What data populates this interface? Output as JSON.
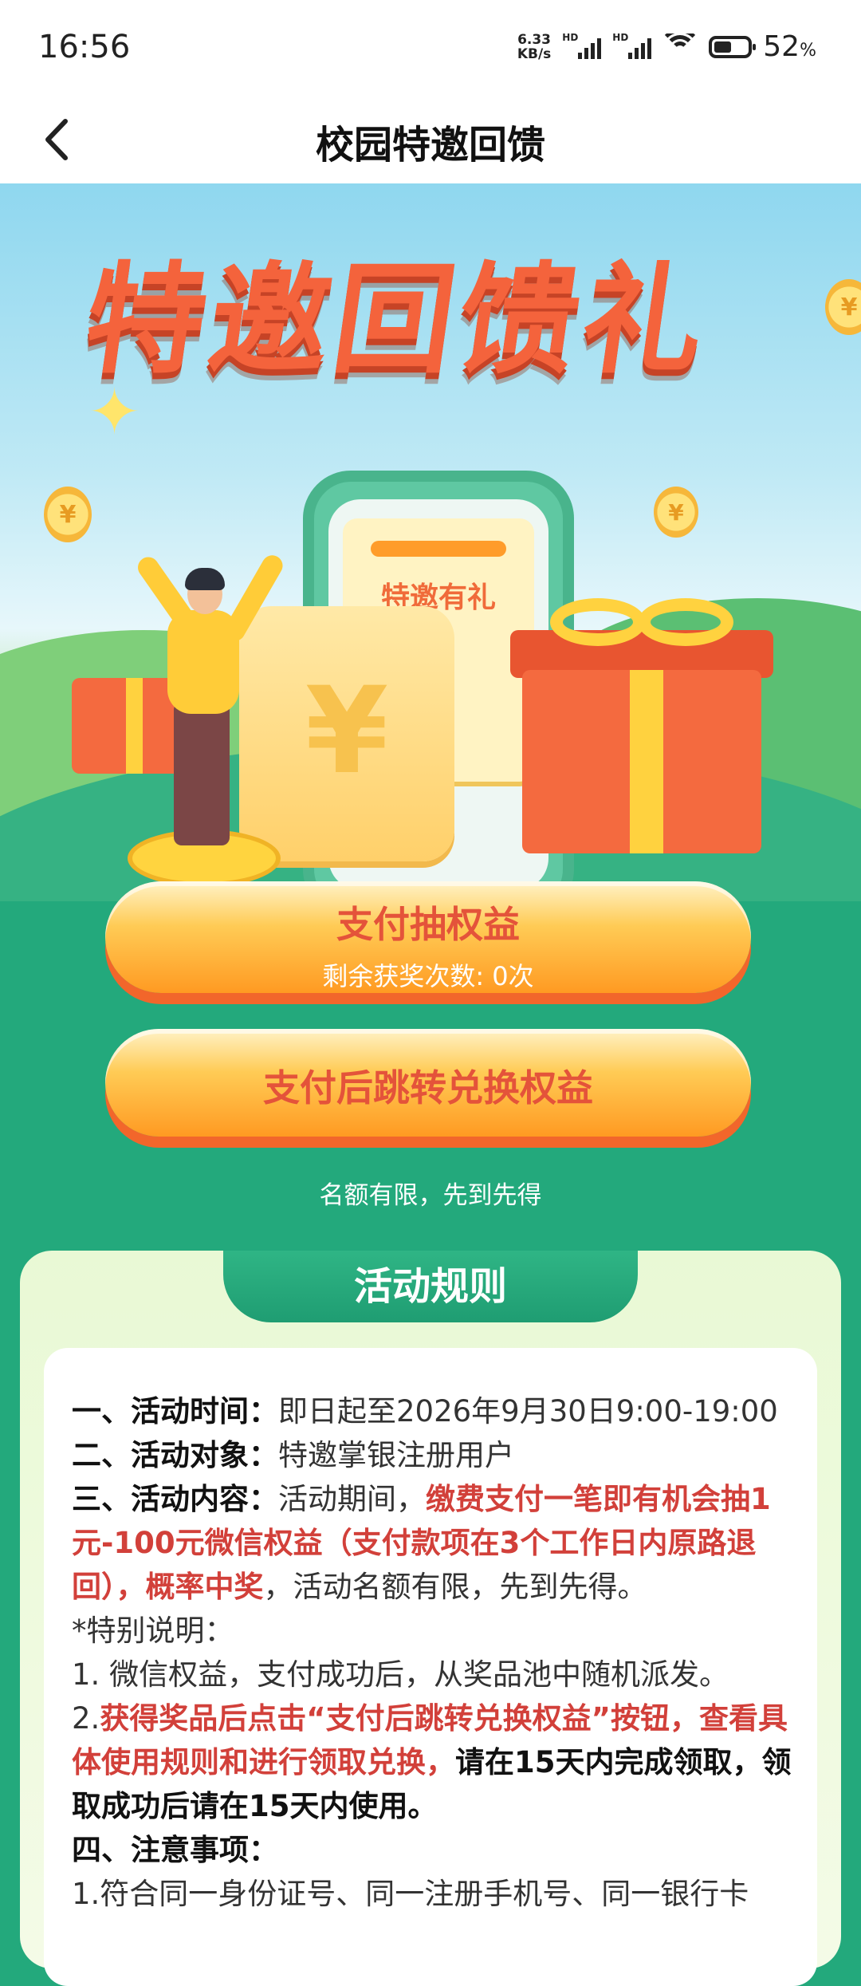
{
  "status_bar": {
    "time": "16:56",
    "net_speed_value": "6.33",
    "net_speed_unit": "KB/s",
    "signal_label": "HD",
    "battery_percent": "52",
    "battery_unit": "%",
    "battery_level": 0.52
  },
  "nav": {
    "title": "校园特邀回馈",
    "back_icon": "chevron-left-icon"
  },
  "banner": {
    "headline": "特邀回馈礼",
    "receipt_text": "特邀有礼",
    "scroll_symbol": "¥",
    "coin_symbol": "¥"
  },
  "buttons": {
    "draw_label": "支付抽权益",
    "draw_sub": "剩余获奖次数: 0次",
    "redeem_label": "支付后跳转兑换权益"
  },
  "note": "名额有限，先到先得",
  "rules": {
    "title": "活动规则",
    "time_label": "一、活动时间：",
    "time_value": "即日起至2026年9月30日9:00-19:00",
    "target_label": "二、活动对象：",
    "target_value": "特邀掌银注册用户",
    "content_label": "三、活动内容：",
    "content_a": "活动期间，",
    "content_b": "缴费支付一笔即有机会抽1元-100元微信权益（支付款项在3个工作日内原路退回），概率中奖",
    "content_c": "，活动名额有限，先到先得。",
    "special_label": "*特别说明：",
    "special_1": "1. 微信权益，支付成功后，从奖品池中随机派发。",
    "special_2_num": "2.",
    "special_2_red": "获得奖品后点击“支付后跳转兑换权益”按钮，查看具体使用规则和进行领取兑换，",
    "special_2_dark": "请在15天内完成领取，领取成功后请在15天内使用。",
    "notice_label": "四、注意事项：",
    "notice_1": "1.符合同一身份证号、同一注册手机号、同一银行卡"
  }
}
